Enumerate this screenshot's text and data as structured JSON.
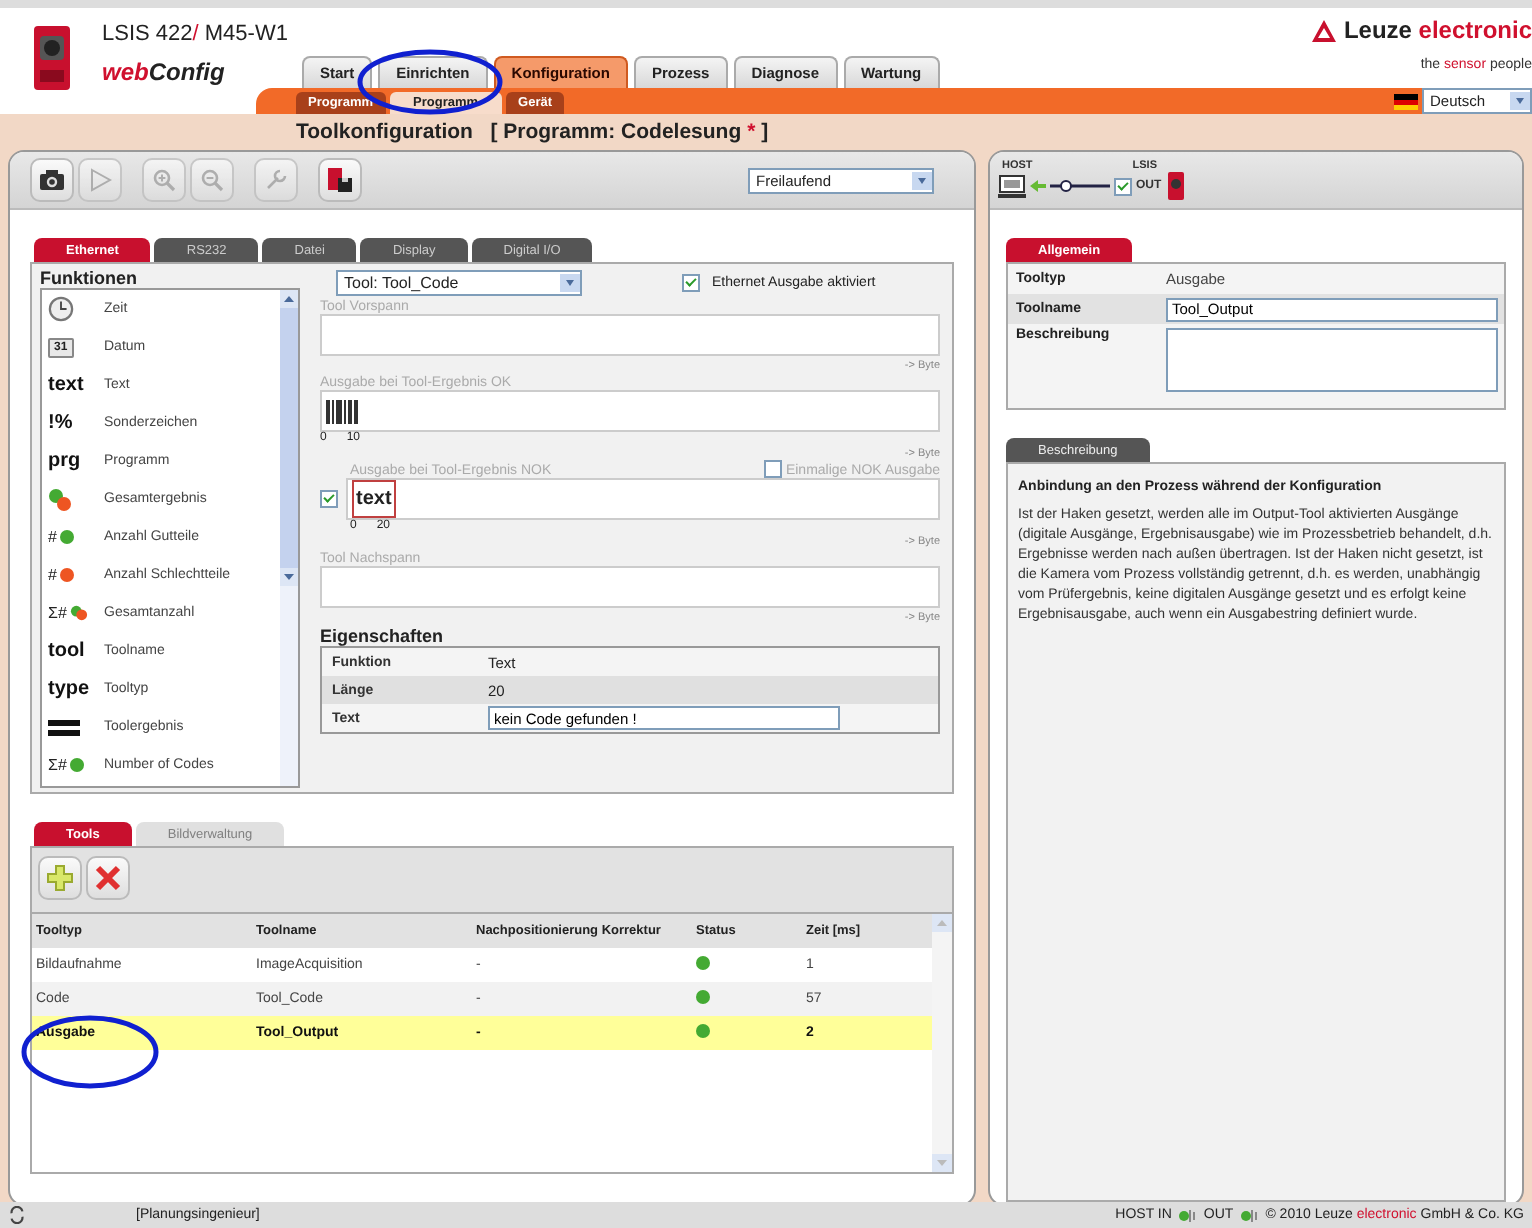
{
  "header": {
    "product_prefix": "LSIS 422",
    "product_slash": "/",
    "product_suffix": " M45-W1",
    "app_web": "web",
    "app_config": "Config",
    "brand_name": "Leuze",
    "brand_accent": "electronic",
    "tagline_start": "the ",
    "tagline_accent": "sensor",
    "tagline_end": " people"
  },
  "main_tabs": [
    {
      "label": "Start",
      "selected": false
    },
    {
      "label": "Einrichten",
      "selected": false
    },
    {
      "label": "Konfiguration",
      "selected": true
    },
    {
      "label": "Prozess",
      "selected": false
    },
    {
      "label": "Diagnose",
      "selected": false
    },
    {
      "label": "Wartung",
      "selected": false
    }
  ],
  "sub_tabs": [
    {
      "label": "Programm",
      "selected": false
    },
    {
      "label": "Programm",
      "selected": true
    },
    {
      "label": "Gerät",
      "selected": false
    }
  ],
  "language": "Deutsch",
  "page_title": {
    "title": "Toolkonfiguration",
    "context": "[ Programm: Codelesung",
    "modified_mark": "*",
    "close": "]"
  },
  "toolbar": {
    "buttons": [
      {
        "kind": "camera",
        "disabled": false
      },
      {
        "kind": "play",
        "disabled": true
      },
      {
        "kind": "zoom_in",
        "disabled": true
      },
      {
        "kind": "zoom_out",
        "disabled": true
      },
      {
        "kind": "wrench",
        "disabled": true
      },
      {
        "kind": "save",
        "disabled": false
      }
    ],
    "trigger_mode": "Freilaufend"
  },
  "output_tabs": [
    {
      "label": "Ethernet",
      "selected": true
    },
    {
      "label": "RS232",
      "selected": false
    },
    {
      "label": "Datei",
      "selected": false
    },
    {
      "label": "Display",
      "selected": false
    },
    {
      "label": "Digital I/O",
      "selected": false
    }
  ],
  "functions": {
    "title": "Funktionen",
    "items": [
      {
        "kind": "clock",
        "label": "Zeit"
      },
      {
        "kind": "calendar",
        "icon_text": "31",
        "label": "Datum"
      },
      {
        "kind": "glyph",
        "icon_text": "text",
        "label": "Text"
      },
      {
        "kind": "glyph",
        "icon_text": "!%",
        "label": "Sonderzeichen"
      },
      {
        "kind": "glyph",
        "icon_text": "prg",
        "label": "Programm"
      },
      {
        "kind": "dots",
        "label": "Gesamtergebnis"
      },
      {
        "kind": "count",
        "icon_text": "#",
        "color": "#44aa33",
        "label": "Anzahl Gutteile"
      },
      {
        "kind": "count",
        "icon_text": "#",
        "color": "#ee5522",
        "label": "Anzahl Schlechtteile"
      },
      {
        "kind": "count_dots",
        "icon_text": "Σ#",
        "label": "Gesamtanzahl"
      },
      {
        "kind": "glyph",
        "icon_text": "tool",
        "label": "Toolname"
      },
      {
        "kind": "glyph",
        "icon_text": "type",
        "label": "Tooltyp"
      },
      {
        "kind": "bars",
        "label": "Toolergebnis"
      },
      {
        "kind": "count",
        "icon_text": "Σ#",
        "color": "#44aa33",
        "label": "Number of Codes"
      }
    ]
  },
  "output_config": {
    "tool_select": "Tool: Tool_Code",
    "ethernet_output": {
      "label": "Ethernet Ausgabe aktiviert",
      "checked": true
    },
    "sections": [
      {
        "kind": "plain",
        "label": "Tool Vorspann",
        "unit": "-> Byte"
      },
      {
        "kind": "barcode",
        "label": "Ausgabe bei Tool-Ergebnis OK",
        "scale_start": "0",
        "scale_end": "10",
        "unit": "-> Byte"
      },
      {
        "kind": "text_chip",
        "label": "Ausgabe bei Tool-Ergebnis NOK",
        "enabled": true,
        "chip_text": "text",
        "once_label": "Einmalige NOK Ausgabe",
        "once_checked": false,
        "scale_start": "0",
        "scale_end": "20",
        "unit": "-> Byte"
      },
      {
        "kind": "plain",
        "label": "Tool Nachspann",
        "unit": "-> Byte"
      }
    ]
  },
  "properties": {
    "title": "Eigenschaften",
    "rows": [
      {
        "kind": "text",
        "label": "Funktion",
        "value": "Text"
      },
      {
        "kind": "text",
        "label": "Länge",
        "value": "20"
      },
      {
        "kind": "input",
        "label": "Text",
        "value": "kein Code gefunden !"
      }
    ]
  },
  "tools_tabs": [
    {
      "label": "Tools",
      "selected": true,
      "disabled": false
    },
    {
      "label": "Bildverwaltung",
      "selected": false,
      "disabled": true
    }
  ],
  "tools_table": {
    "columns": [
      "Tooltyp",
      "Toolname",
      "Nachpositionierung Korrektur",
      "Status",
      "Zeit [ms]"
    ],
    "rows": [
      {
        "type": "Bildaufnahme",
        "name": "ImageAcquisition",
        "correction": "-",
        "color": "#44aa33",
        "time": "1",
        "selected": false
      },
      {
        "type": "Code",
        "name": "Tool_Code",
        "correction": "-",
        "color": "#44aa33",
        "time": "57",
        "selected": false
      },
      {
        "type": "Ausgabe",
        "name": "Tool_Output",
        "correction": "-",
        "color": "#44aa33",
        "time": "2",
        "selected": true
      }
    ]
  },
  "connection": {
    "host_label": "HOST",
    "device_label": "LSIS",
    "out_label": "OUT",
    "out_checked": true
  },
  "general_tab": "Allgemein",
  "general": {
    "tooltype_label": "Tooltyp",
    "tooltype": "Ausgabe",
    "toolname_label": "Toolname",
    "toolname": "Tool_Output",
    "description_label": "Beschreibung"
  },
  "description_tab": "Beschreibung",
  "description": {
    "heading": "Anbindung an den Prozess während der Konfiguration",
    "text": "Ist der Haken gesetzt, werden alle im Output-Tool aktivierten Ausgänge (digitale Ausgänge, Ergebnisausgabe) wie im Prozessbetrieb behandelt, d.h. Ergebnisse werden nach außen übertragen. Ist der Haken nicht gesetzt, ist die Kamera vom Prozess vollständig getrennt, d.h. es werden, unabhängig vom Prüfergebnis, keine digitalen Ausgänge gesetzt und es erfolgt keine Ergebnisausgabe, auch wenn ein Ausgabestring definiert wurde."
  },
  "status_bar": {
    "role": "[Planungsingenieur]",
    "host_in": "HOST IN",
    "out": "OUT",
    "copyright_start": "© 2010 Leuze ",
    "copyright_accent": "electronic",
    "copyright_end": " GmbH & Co. KG"
  }
}
